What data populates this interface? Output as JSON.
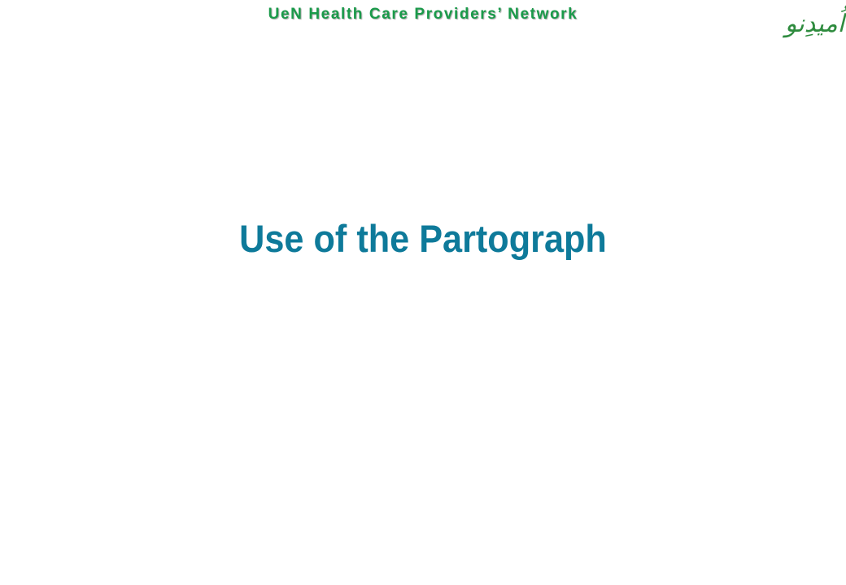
{
  "header": {
    "network_name": "UeN Health Care Providers’ Network"
  },
  "logo": {
    "text": "اُمیدِنو"
  },
  "slide": {
    "title": "Use of the Partograph"
  },
  "colors": {
    "header_green": "#1a9a4a",
    "title_teal": "#0e7a9a",
    "logo_green": "#2e8b3e",
    "background": "#ffffff"
  }
}
